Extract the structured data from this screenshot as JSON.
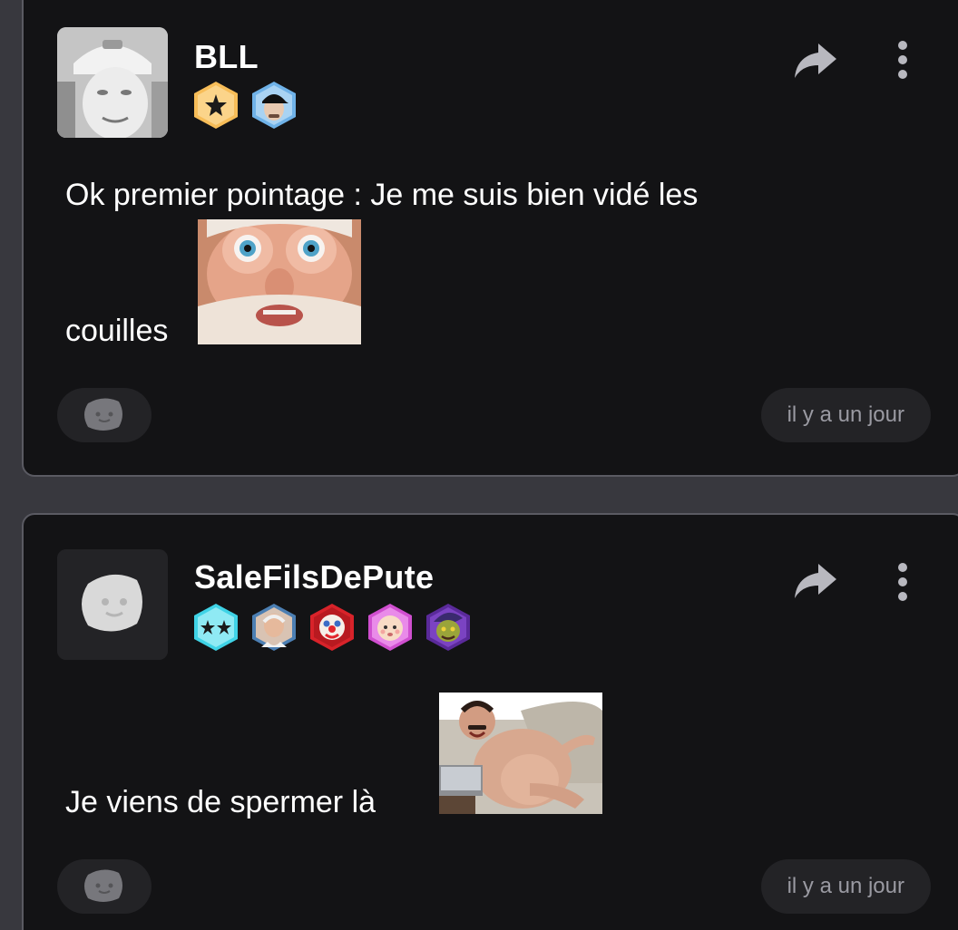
{
  "posts": [
    {
      "username": "BLL",
      "badges": [
        "star-badge-gold",
        "cap-guy-badge"
      ],
      "text_line1": "Ok premier pointage : Je me suis bien vidé les",
      "text_line2": "couilles",
      "sticker": "wide-eyed-old-man-sticker",
      "timestamp": "il y a un jour"
    },
    {
      "username": "SaleFilsDePute",
      "badges": [
        "two-stars-cyan-badge",
        "hide-the-pain-harold-badge",
        "clown-badge",
        "baby-face-badge",
        "goblin-badge"
      ],
      "text_line1": "Je viens de spermer là",
      "sticker": "laughing-man-sticker",
      "timestamp": "il y a un jour"
    }
  ],
  "colors": {
    "page_background": "#38383e",
    "card_background": "#131315",
    "card_border": "#5a5a62",
    "chip_background": "#232326",
    "muted_text": "#9a9aa2",
    "icon_gray": "#b8b8bf"
  }
}
